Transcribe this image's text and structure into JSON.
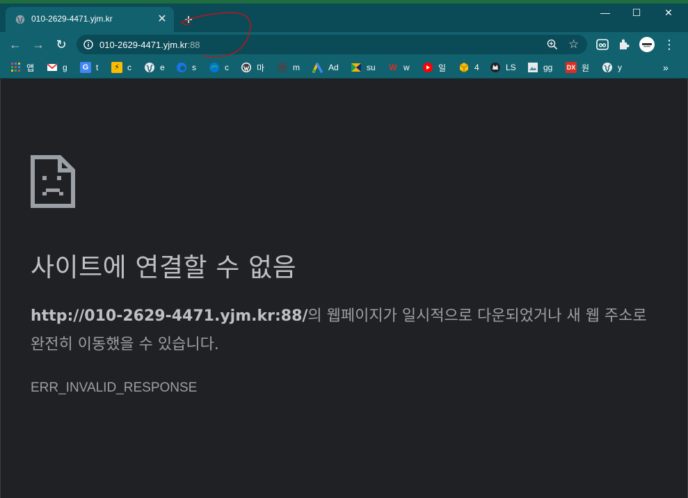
{
  "tab": {
    "title": "010-2629-4471.yjm.kr",
    "close_glyph": "✕"
  },
  "new_tab_glyph": "+",
  "window_controls": {
    "minimize": "—",
    "maximize": "☐",
    "close": "✕"
  },
  "toolbar": {
    "back_glyph": "←",
    "forward_glyph": "→",
    "reload_glyph": "↻",
    "url_host": "010-2629-4471.yjm.kr",
    "url_port": ":88",
    "star_glyph": "☆",
    "menu_glyph": "⋮"
  },
  "bookmarks": [
    {
      "label": "앱",
      "icon": "apps-grid-icon",
      "color": "#4285f4"
    },
    {
      "label": "g",
      "icon": "gmail-icon",
      "color": "#ea4335"
    },
    {
      "label": "t",
      "icon": "google-translate-icon",
      "color": "#4285f4"
    },
    {
      "label": "c",
      "icon": "lightning-icon",
      "color": "#fbbc04"
    },
    {
      "label": "e",
      "icon": "globe-icon",
      "color": "#8ab4f8"
    },
    {
      "label": "s",
      "icon": "edge-icon",
      "color": "#1a73e8"
    },
    {
      "label": "c",
      "icon": "edge-icon",
      "color": "#0078d7"
    },
    {
      "label": "마",
      "icon": "wordpress-icon",
      "color": "#ffffff"
    },
    {
      "label": "m",
      "icon": "gear-icon",
      "color": "#5f3b3b"
    },
    {
      "label": "Ad",
      "icon": "google-ads-icon",
      "color": "#34a853"
    },
    {
      "label": "su",
      "icon": "flag-icon",
      "color": "#f4b400"
    },
    {
      "label": "w",
      "icon": "w-logo-icon",
      "color": "#d93025"
    },
    {
      "label": "일",
      "icon": "youtube-icon",
      "color": "#ff0000"
    },
    {
      "label": "4",
      "icon": "cube-icon",
      "color": "#fbbc04"
    },
    {
      "label": "LS",
      "icon": "wolf-icon",
      "color": "#202124"
    },
    {
      "label": "gg",
      "icon": "image-icon",
      "color": "#e8eaed"
    },
    {
      "label": "원",
      "icon": "dx-icon",
      "color": "#d93025"
    },
    {
      "label": "y",
      "icon": "globe-icon",
      "color": "#8ab4f8"
    }
  ],
  "bookmarks_overflow": "»",
  "error": {
    "title": "사이트에 연결할 수 없음",
    "url": "http://010-2629-4471.yjm.kr:88/",
    "description_rest": "의 웹페이지가 일시적으로 다운되었거나 새 웹 주소로 완전히 이동했을 수 있습니다.",
    "code": "ERR_INVALID_RESPONSE"
  },
  "colors": {
    "frame": "#0b4a57",
    "toolbar": "#12616e",
    "page_bg": "#202124",
    "text_primary": "#bdc1c6",
    "text_secondary": "#9aa0a6",
    "annotation": "#c0141c"
  }
}
